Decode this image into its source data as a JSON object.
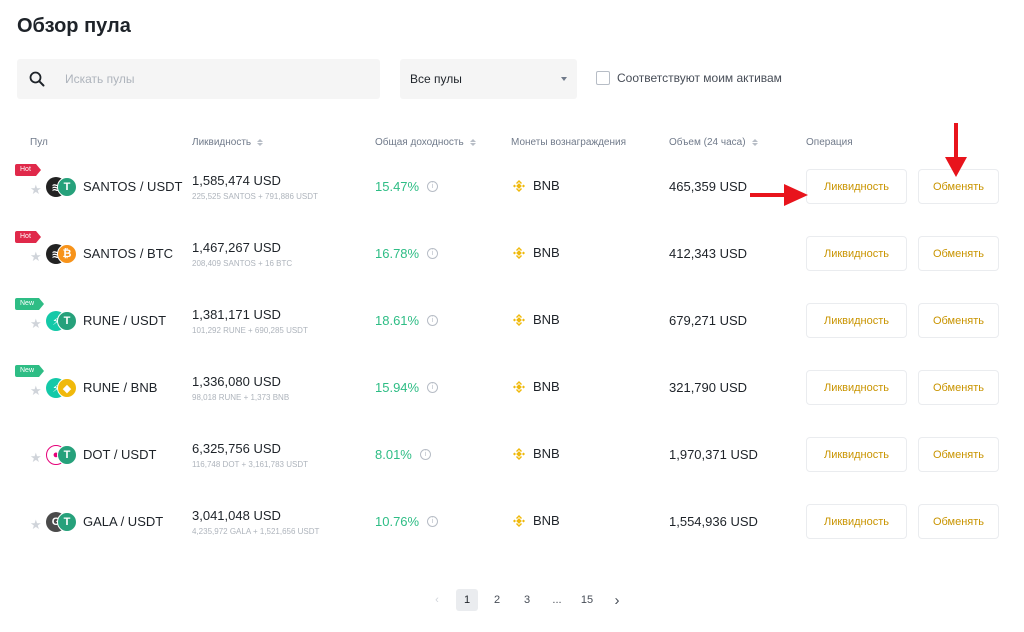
{
  "page": {
    "title": "Обзор пула"
  },
  "search": {
    "placeholder": "Искать пулы"
  },
  "filter": {
    "selected": "Все пулы"
  },
  "match_assets": {
    "label": "Соответствуют моим активам",
    "checked": false
  },
  "columns": {
    "pool": "Пул",
    "liquidity": "Ликвидность",
    "apr": "Общая доходность",
    "rewards": "Монеты вознаграждения",
    "volume": "Объем (24 часа)",
    "operation": "Операция"
  },
  "rows": [
    {
      "badge": "Hot",
      "badge_type": "hot",
      "pair": "SANTOS / USDT",
      "coin1": "santos",
      "coin2": "usdt",
      "liquidity": "1,585,474 USD",
      "liquidity_detail": "225,525 SANTOS + 791,886 USDT",
      "apr": "15.47%",
      "reward": "BNB",
      "volume": "465,359 USD",
      "liq_btn": "Ликвидность",
      "swap_btn": "Обменять"
    },
    {
      "badge": "Hot",
      "badge_type": "hot",
      "pair": "SANTOS / BTC",
      "coin1": "santos",
      "coin2": "btc",
      "liquidity": "1,467,267 USD",
      "liquidity_detail": "208,409 SANTOS + 16 BTC",
      "apr": "16.78%",
      "reward": "BNB",
      "volume": "412,343 USD",
      "liq_btn": "Ликвидность",
      "swap_btn": "Обменять"
    },
    {
      "badge": "New",
      "badge_type": "new",
      "pair": "RUNE / USDT",
      "coin1": "rune",
      "coin2": "usdt",
      "liquidity": "1,381,171 USD",
      "liquidity_detail": "101,292 RUNE + 690,285 USDT",
      "apr": "18.61%",
      "reward": "BNB",
      "volume": "679,271 USD",
      "liq_btn": "Ликвидность",
      "swap_btn": "Обменять"
    },
    {
      "badge": "New",
      "badge_type": "new",
      "pair": "RUNE / BNB",
      "coin1": "rune",
      "coin2": "bnb",
      "liquidity": "1,336,080 USD",
      "liquidity_detail": "98,018 RUNE + 1,373 BNB",
      "apr": "15.94%",
      "reward": "BNB",
      "volume": "321,790 USD",
      "liq_btn": "Ликвидность",
      "swap_btn": "Обменять"
    },
    {
      "badge": "",
      "badge_type": "",
      "pair": "DOT / USDT",
      "coin1": "dot",
      "coin2": "usdt",
      "liquidity": "6,325,756 USD",
      "liquidity_detail": "116,748 DOT + 3,161,783 USDT",
      "apr": "8.01%",
      "reward": "BNB",
      "volume": "1,970,371 USD",
      "liq_btn": "Ликвидность",
      "swap_btn": "Обменять"
    },
    {
      "badge": "",
      "badge_type": "",
      "pair": "GALA / USDT",
      "coin1": "gala",
      "coin2": "usdt",
      "liquidity": "3,041,048 USD",
      "liquidity_detail": "4,235,972 GALA + 1,521,656 USDT",
      "apr": "10.76%",
      "reward": "BNB",
      "volume": "1,554,936 USD",
      "liq_btn": "Ликвидность",
      "swap_btn": "Обменять"
    }
  ],
  "pagination": {
    "pages": [
      "1",
      "2",
      "3",
      "...",
      "15"
    ],
    "current": "1"
  },
  "colors": {
    "positive": "#2ebd85",
    "accent": "#c99400",
    "hot": "#e0294a",
    "new": "#2ebd85",
    "bnb": "#f0b90b",
    "usdt": "#26a17b",
    "btc": "#f7931a",
    "arrow": "#e8141c"
  }
}
